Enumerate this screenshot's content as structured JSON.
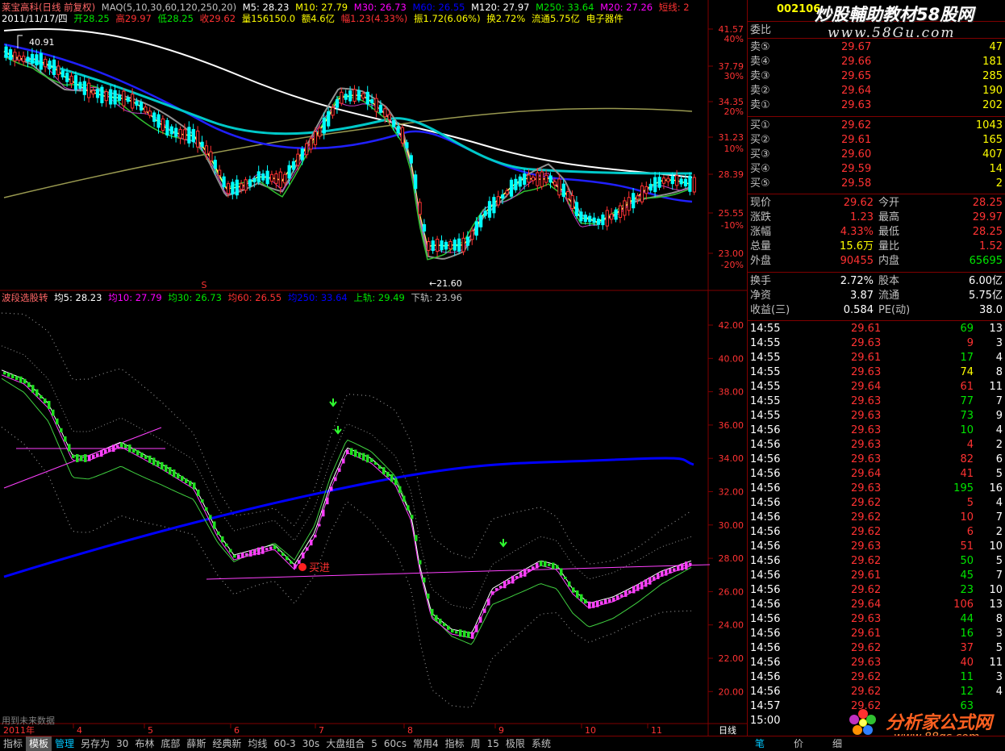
{
  "colors": {
    "red": "#ff3232",
    "green": "#00e600",
    "white": "#ffffff",
    "yellow": "#ffff00",
    "cyan": "#00c8c8",
    "blue": "#0000ff",
    "magenta": "#ff00ff",
    "olive": "#999950"
  },
  "main": {
    "title": "莱宝高科(日线 前复权)",
    "ma_label": "MAQ(5,10,30,60,120,250,20)",
    "m5": "M5: 28.23",
    "m10": "M10: 27.79",
    "m30": "M30: 26.73",
    "m60": "M60: 26.55",
    "m120": "M120: 27.97",
    "m250": "M250: 33.64",
    "m20": "M20: 27.26",
    "short": "短线: 2",
    "date": "2011/11/17/四",
    "open": "开28.25",
    "high": "高29.97",
    "low": "低28.25",
    "close": "收29.62",
    "vol": "量156150.0",
    "amt": "额4.6亿",
    "chg": "幅1.23(4.33%)",
    "amp": "振1.72(6.06%)",
    "turn": "换2.72%",
    "float": "流通5.75亿",
    "sector": "电子器件",
    "peak": "40.91",
    "trough": "←21.60",
    "s_marker": "S",
    "price_ticks": [
      "41.57",
      "37.79",
      "34.35",
      "31.23",
      "28.39",
      "25.55",
      "23.00"
    ],
    "pct_ticks": [
      "40%",
      "30%",
      "20%",
      "10%",
      "-10%",
      "-20%"
    ]
  },
  "indicator": {
    "name": "波段选股转",
    "j5": "均5: 28.23",
    "j10": "均10: 27.79",
    "j30": "均30: 26.73",
    "j60": "均60: 26.55",
    "j250": "均250: 33.64",
    "upper": "上轨: 29.49",
    "lower": "下轨: 23.96",
    "buy": "买进",
    "ticks": [
      "42.00",
      "40.00",
      "38.00",
      "36.00",
      "34.00",
      "32.00",
      "30.00",
      "28.00",
      "26.00",
      "24.00",
      "22.00",
      "20.00"
    ]
  },
  "xaxis": {
    "year": "2011年",
    "months": [
      "4",
      "5",
      "6",
      "7",
      "8",
      "9",
      "10",
      "11"
    ],
    "period": "日线",
    "note": "用到未来数据"
  },
  "panel": {
    "code": "002106",
    "weibi": "委比",
    "sell": [
      {
        "label": "卖⑤",
        "price": "29.67",
        "vol": "47"
      },
      {
        "label": "卖④",
        "price": "29.66",
        "vol": "181"
      },
      {
        "label": "卖③",
        "price": "29.65",
        "vol": "285"
      },
      {
        "label": "卖②",
        "price": "29.64",
        "vol": "190"
      },
      {
        "label": "卖①",
        "price": "29.63",
        "vol": "202"
      }
    ],
    "buy": [
      {
        "label": "买①",
        "price": "29.62",
        "vol": "1043"
      },
      {
        "label": "买②",
        "price": "29.61",
        "vol": "165"
      },
      {
        "label": "买③",
        "price": "29.60",
        "vol": "407"
      },
      {
        "label": "买④",
        "price": "29.59",
        "vol": "14"
      },
      {
        "label": "买⑤",
        "price": "29.58",
        "vol": "2"
      }
    ],
    "quote": [
      {
        "l1": "现价",
        "v1": "29.62",
        "c1": "red",
        "l2": "今开",
        "v2": "28.25",
        "c2": "red"
      },
      {
        "l1": "涨跌",
        "v1": "1.23",
        "c1": "red",
        "l2": "最高",
        "v2": "29.97",
        "c2": "red"
      },
      {
        "l1": "涨幅",
        "v1": "4.33%",
        "c1": "red",
        "l2": "最低",
        "v2": "28.25",
        "c2": "red"
      },
      {
        "l1": "总量",
        "v1": "15.6万",
        "c1": "yellow",
        "l2": "量比",
        "v2": "1.52",
        "c2": "red"
      },
      {
        "l1": "外盘",
        "v1": "90455",
        "c1": "red",
        "l2": "内盘",
        "v2": "65695",
        "c2": "green"
      }
    ],
    "info": [
      {
        "l1": "换手",
        "v1": "2.72%",
        "l2": "股本",
        "v2": "6.00亿"
      },
      {
        "l1": "净资",
        "v1": "3.87",
        "l2": "流通",
        "v2": "5.75亿"
      },
      {
        "l1": "收益(三)",
        "v1": "0.584",
        "l2": "PE(动)",
        "v2": "38.0"
      }
    ],
    "ticks": [
      [
        "14:55",
        "29.61",
        "69",
        "13",
        "r",
        "g"
      ],
      [
        "14:55",
        "29.63",
        "9",
        "3",
        "r",
        "r"
      ],
      [
        "14:55",
        "29.61",
        "17",
        "4",
        "r",
        "g"
      ],
      [
        "14:55",
        "29.63",
        "74",
        "8",
        "r",
        "y"
      ],
      [
        "14:55",
        "29.64",
        "61",
        "11",
        "r",
        "r"
      ],
      [
        "14:55",
        "29.63",
        "77",
        "7",
        "r",
        "g"
      ],
      [
        "14:55",
        "29.63",
        "73",
        "9",
        "r",
        "g"
      ],
      [
        "14:56",
        "29.63",
        "10",
        "4",
        "r",
        "g"
      ],
      [
        "14:56",
        "29.63",
        "4",
        "2",
        "r",
        "r"
      ],
      [
        "14:56",
        "29.63",
        "82",
        "6",
        "r",
        "r"
      ],
      [
        "14:56",
        "29.64",
        "41",
        "5",
        "r",
        "r"
      ],
      [
        "14:56",
        "29.63",
        "195",
        "16",
        "r",
        "g"
      ],
      [
        "14:56",
        "29.62",
        "5",
        "4",
        "r",
        "r"
      ],
      [
        "14:56",
        "29.62",
        "10",
        "7",
        "r",
        "r"
      ],
      [
        "14:56",
        "29.62",
        "6",
        "2",
        "r",
        "r"
      ],
      [
        "14:56",
        "29.63",
        "51",
        "10",
        "r",
        "r"
      ],
      [
        "14:56",
        "29.62",
        "50",
        "5",
        "r",
        "g"
      ],
      [
        "14:56",
        "29.61",
        "45",
        "7",
        "r",
        "g"
      ],
      [
        "14:56",
        "29.62",
        "23",
        "10",
        "r",
        "g"
      ],
      [
        "14:56",
        "29.64",
        "106",
        "13",
        "r",
        "r"
      ],
      [
        "14:56",
        "29.63",
        "44",
        "8",
        "r",
        "g"
      ],
      [
        "14:56",
        "29.61",
        "16",
        "3",
        "r",
        "g"
      ],
      [
        "14:56",
        "29.62",
        "37",
        "5",
        "r",
        "r"
      ],
      [
        "14:56",
        "29.63",
        "40",
        "11",
        "r",
        "r"
      ],
      [
        "14:56",
        "29.62",
        "11",
        "3",
        "r",
        "g"
      ],
      [
        "14:56",
        "29.62",
        "12",
        "4",
        "r",
        "g"
      ],
      [
        "14:57",
        "29.62",
        "63",
        "",
        "r",
        "g"
      ],
      [
        "15:00",
        "",
        "",
        "",
        "r",
        "g"
      ]
    ],
    "tabs": [
      "笔",
      "价",
      "细"
    ]
  },
  "toolbar": [
    "指标",
    "模板",
    "管理",
    "另存为",
    "30",
    "布林",
    "底部",
    "薛斯",
    "经典新",
    "均线",
    "60-3",
    "30s",
    "大盘组合",
    "5",
    "60cs",
    "常用4",
    "指标",
    "周",
    "15",
    "极限",
    "系统"
  ],
  "watermark": {
    "top": "炒股輔助教材58股网",
    "url": "www.58Gu.com",
    "bottom": "分析家公式网",
    "bottom_url": "www.88gs.com"
  }
}
